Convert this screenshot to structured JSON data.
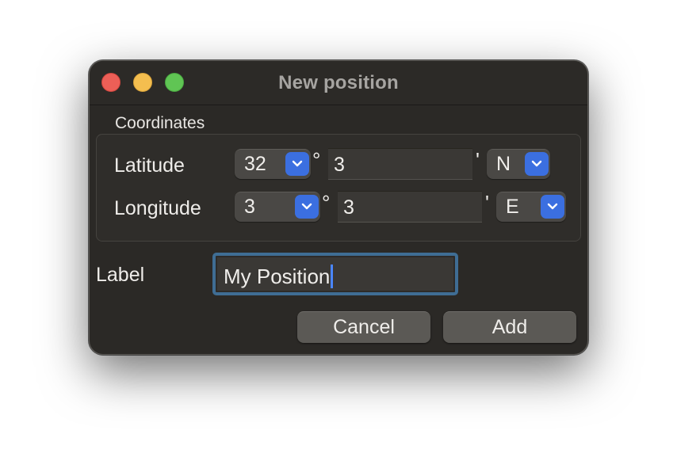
{
  "window": {
    "title": "New position"
  },
  "coordinates": {
    "group_label": "Coordinates",
    "latitude": {
      "label": "Latitude",
      "degrees": "32",
      "degree_symbol": "°",
      "minutes": "3",
      "minute_symbol": "'",
      "hemisphere": "N"
    },
    "longitude": {
      "label": "Longitude",
      "degrees": "3",
      "degree_symbol": "°",
      "minutes": "3",
      "minute_symbol": "'",
      "hemisphere": "E"
    }
  },
  "label_field": {
    "label": "Label",
    "value": "My Position"
  },
  "buttons": {
    "cancel": "Cancel",
    "add": "Add"
  },
  "colors": {
    "window_bg": "#2b2926",
    "accent": "#3b6fe0",
    "focus_ring": "#3f6d94",
    "close": "#ec5f57",
    "minimize": "#f4be4f",
    "maximize": "#60c554"
  },
  "icons": {
    "popup_arrow": "chevron-down-icon"
  }
}
